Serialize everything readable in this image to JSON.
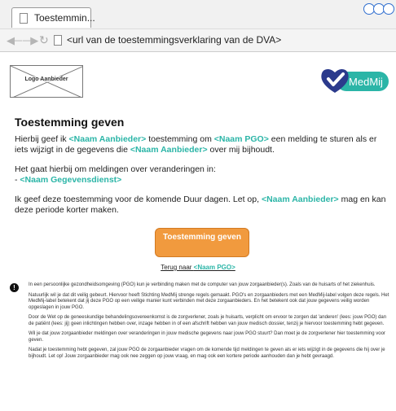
{
  "browser": {
    "tab_title": "Toestemmin...",
    "url": "<url van de toestemmingsverklaring van de DVA>",
    "icons": {
      "back": "back-arrow-icon",
      "forward": "forward-arrow-icon",
      "reload": "reload-icon",
      "page": "page-icon"
    }
  },
  "header": {
    "logo_placeholder": "Logo Aanbieder",
    "brand_logo": "MedMij"
  },
  "content": {
    "title": "Toestemming geven",
    "p1": {
      "t1": "Hierbij geef ik ",
      "aanbieder": "<Naam Aanbieder>",
      "t2": " toestemming om ",
      "pgo": "<Naam PGO>",
      "t3": " een melding te sturen als er iets wijzigt in de gegevens die ",
      "aanbieder2": "<Naam Aanbieder>",
      "t4": " over mij bijhoudt."
    },
    "p2": {
      "line1": "Het gaat hierbij om meldingen over veranderingen in:",
      "dash": "- ",
      "dienst": "<Naam Gegevensdienst>"
    },
    "p3": {
      "t1": "Ik geef deze toestemming voor de komende Duur dagen. Let op, ",
      "aanbieder": "<Naam Aanbieder>",
      "t2": " mag en kan deze periode korter maken."
    },
    "button_label": "Toestemming geven",
    "back_link": {
      "prefix": "Terug naar ",
      "pgo": "<Naam PGO>"
    }
  },
  "info": {
    "icon": "info-icon",
    "paragraphs": [
      "In een persoonlijke gezondheidsomgeving (PGO) kun je verbinding maken met de computer van jouw zorgaanbieder(s). Zoals van de huisarts of het ziekenhuis.",
      "Natuurlijk wil je dat dit veilig gebeurt. Hiervoor heeft Stichting MedMij strenge regels gemaakt. PGO's en zorgaanbieders met een MedMij-label volgen deze regels. Het MedMij-label betekent dat jij deze PGO op een veilige manier kunt verbinden met deze zorgaanbieders. En het betekent ook dat jouw gegevens veilig worden opgeslagen in jouw PGO.",
      "Door de Wet op de geneeskundige behandelingsovereenkomst is de zorgverlener, zoals je huisarts, verplicht om ervoor te zorgen dat 'anderen' (lees: jouw PGO) dan de patiënt (lees: jij) geen inlichtingen hebben over, inzage hebben in of een afschrift hebben van jouw medisch dossier, tenzij je hiervoor toestemming hebt gegeven.",
      "Wil je dat jouw zorgaanbieder meldingen over veranderingen in jouw medische gegevens naar jouw PGO stuurt? Dan moet je de zorgverlener hier toestemming voor geven.",
      "Nadat je toestemming hebt gegeven, zal jouw PGO de zorgaanbieder vragen om de komende tijd meldingen te geven als er iets wijzigt in de gegevens die hij over je bijhoudt. Let op! Jouw zorgaanbieder mag ook nee zeggen op jouw vraag, en mag ook een kortere periode aanhouden dan je hebt gevraagd."
    ]
  },
  "colors": {
    "accent": "#2bb5a7",
    "button": "#f19a3e",
    "brand_heart": "#2b3a8c",
    "brand_teal": "#2bb5a7"
  }
}
